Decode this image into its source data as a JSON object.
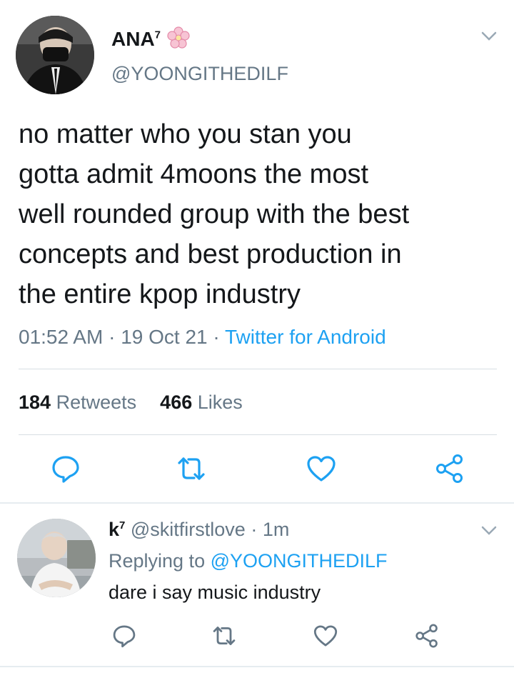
{
  "tweet": {
    "display_name": "ANA",
    "name_sup": "7",
    "handle": "@YOONGITHEDILF",
    "text": "no matter who you stan you\ngotta admit 4moons the most\nwell rounded group with the best\nconcepts and best production in\nthe entire kpop industry",
    "time": "01:52 AM",
    "date": "19 Oct 21",
    "source": "Twitter for Android",
    "retweets_count": "184",
    "retweets_label": "Retweets",
    "likes_count": "466",
    "likes_label": "Likes"
  },
  "reply": {
    "display_name": "k",
    "name_sup": "7",
    "handle": "@skitfirstlove",
    "age": "1m",
    "replying_prefix": "Replying to",
    "replying_handle": "@YOONGITHEDILF",
    "text": "dare i say music industry"
  },
  "icons": {
    "chevron": "chevron-down-icon",
    "reply": "reply-icon",
    "retweet": "retweet-icon",
    "like": "heart-icon",
    "share": "share-icon",
    "flower": "cherry-blossom-icon"
  },
  "colors": {
    "link": "#1da1f2",
    "muted": "#657786",
    "text": "#14171a",
    "blossom": "#f4a9c0"
  }
}
